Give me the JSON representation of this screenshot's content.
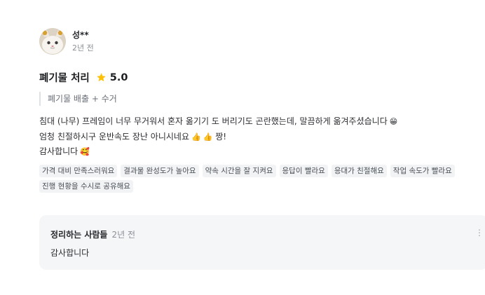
{
  "review": {
    "author": "성**",
    "time": "2년 전",
    "service": "폐기물 처리",
    "rating": "5.0",
    "detail": "폐기물 배출 + 수거",
    "lines": [
      "침대 (나무) 프레임이 너무 무거워서 혼자 옮기기 도 버리기도 곤란했는데, 말끔하게 옮겨주셨습니다",
      "엄청 친절하시구 운반속도 장난 아니시네요",
      "감사합니다"
    ],
    "emoji": {
      "line1": "😁",
      "line2_a": "👍",
      "line2_b": "👍",
      "line2_after": "짱!",
      "line3": "🥰"
    },
    "tags": [
      "가격 대비 만족스러워요",
      "결과물 완성도가 높아요",
      "약속 시간을 잘 지켜요",
      "응답이 빨라요",
      "응대가 친절해요",
      "작업 속도가 빨라요",
      "진행 현황을 수시로 공유해요"
    ]
  },
  "reply": {
    "author": "정리하는 사람들",
    "time": "2년 전",
    "text": "감사합니다",
    "more": "⋮"
  },
  "colors": {
    "star": "#ffc107",
    "tag_bg": "#f1f3f5",
    "reply_bg": "#f5f6f8"
  },
  "icons": {
    "avatar": "cat-photo-avatar",
    "rating": "star-icon"
  }
}
